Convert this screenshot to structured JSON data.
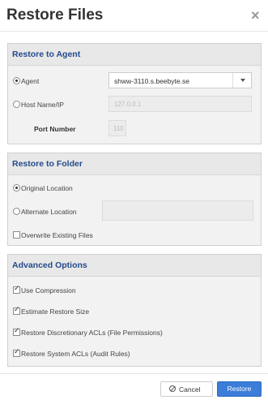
{
  "dialog": {
    "title": "Restore Files",
    "close_symbol": "×"
  },
  "restore_to_agent": {
    "heading": "Restore to Agent",
    "agent_label": "Agent",
    "agent_selected": true,
    "agent_value": "shww-3110.s.beebyte.se",
    "host_label": "Host Name/IP",
    "host_selected": false,
    "host_placeholder": "127.0.0.1",
    "port_label": "Port Number",
    "port_placeholder": "110"
  },
  "restore_to_folder": {
    "heading": "Restore to Folder",
    "original_label": "Original Location",
    "original_selected": true,
    "alternate_label": "Alternate Location",
    "alternate_selected": false,
    "overwrite_label": "Overwrite Existing Files",
    "overwrite_checked": false
  },
  "advanced_options": {
    "heading": "Advanced Options",
    "options": [
      {
        "label": "Use Compression",
        "checked": true
      },
      {
        "label": "Estimate Restore Size",
        "checked": true
      },
      {
        "label": "Restore Discretionary ACLs (File Permissions)",
        "checked": true
      },
      {
        "label": "Restore System ACLs (Audit Rules)",
        "checked": true
      }
    ]
  },
  "footer": {
    "cancel_label": "Cancel",
    "restore_label": "Restore",
    "primary_color": "#3b7dd8"
  },
  "icons": {
    "close": "close-icon",
    "cancel": "ban-icon",
    "dropdown": "chevron-down-icon"
  }
}
